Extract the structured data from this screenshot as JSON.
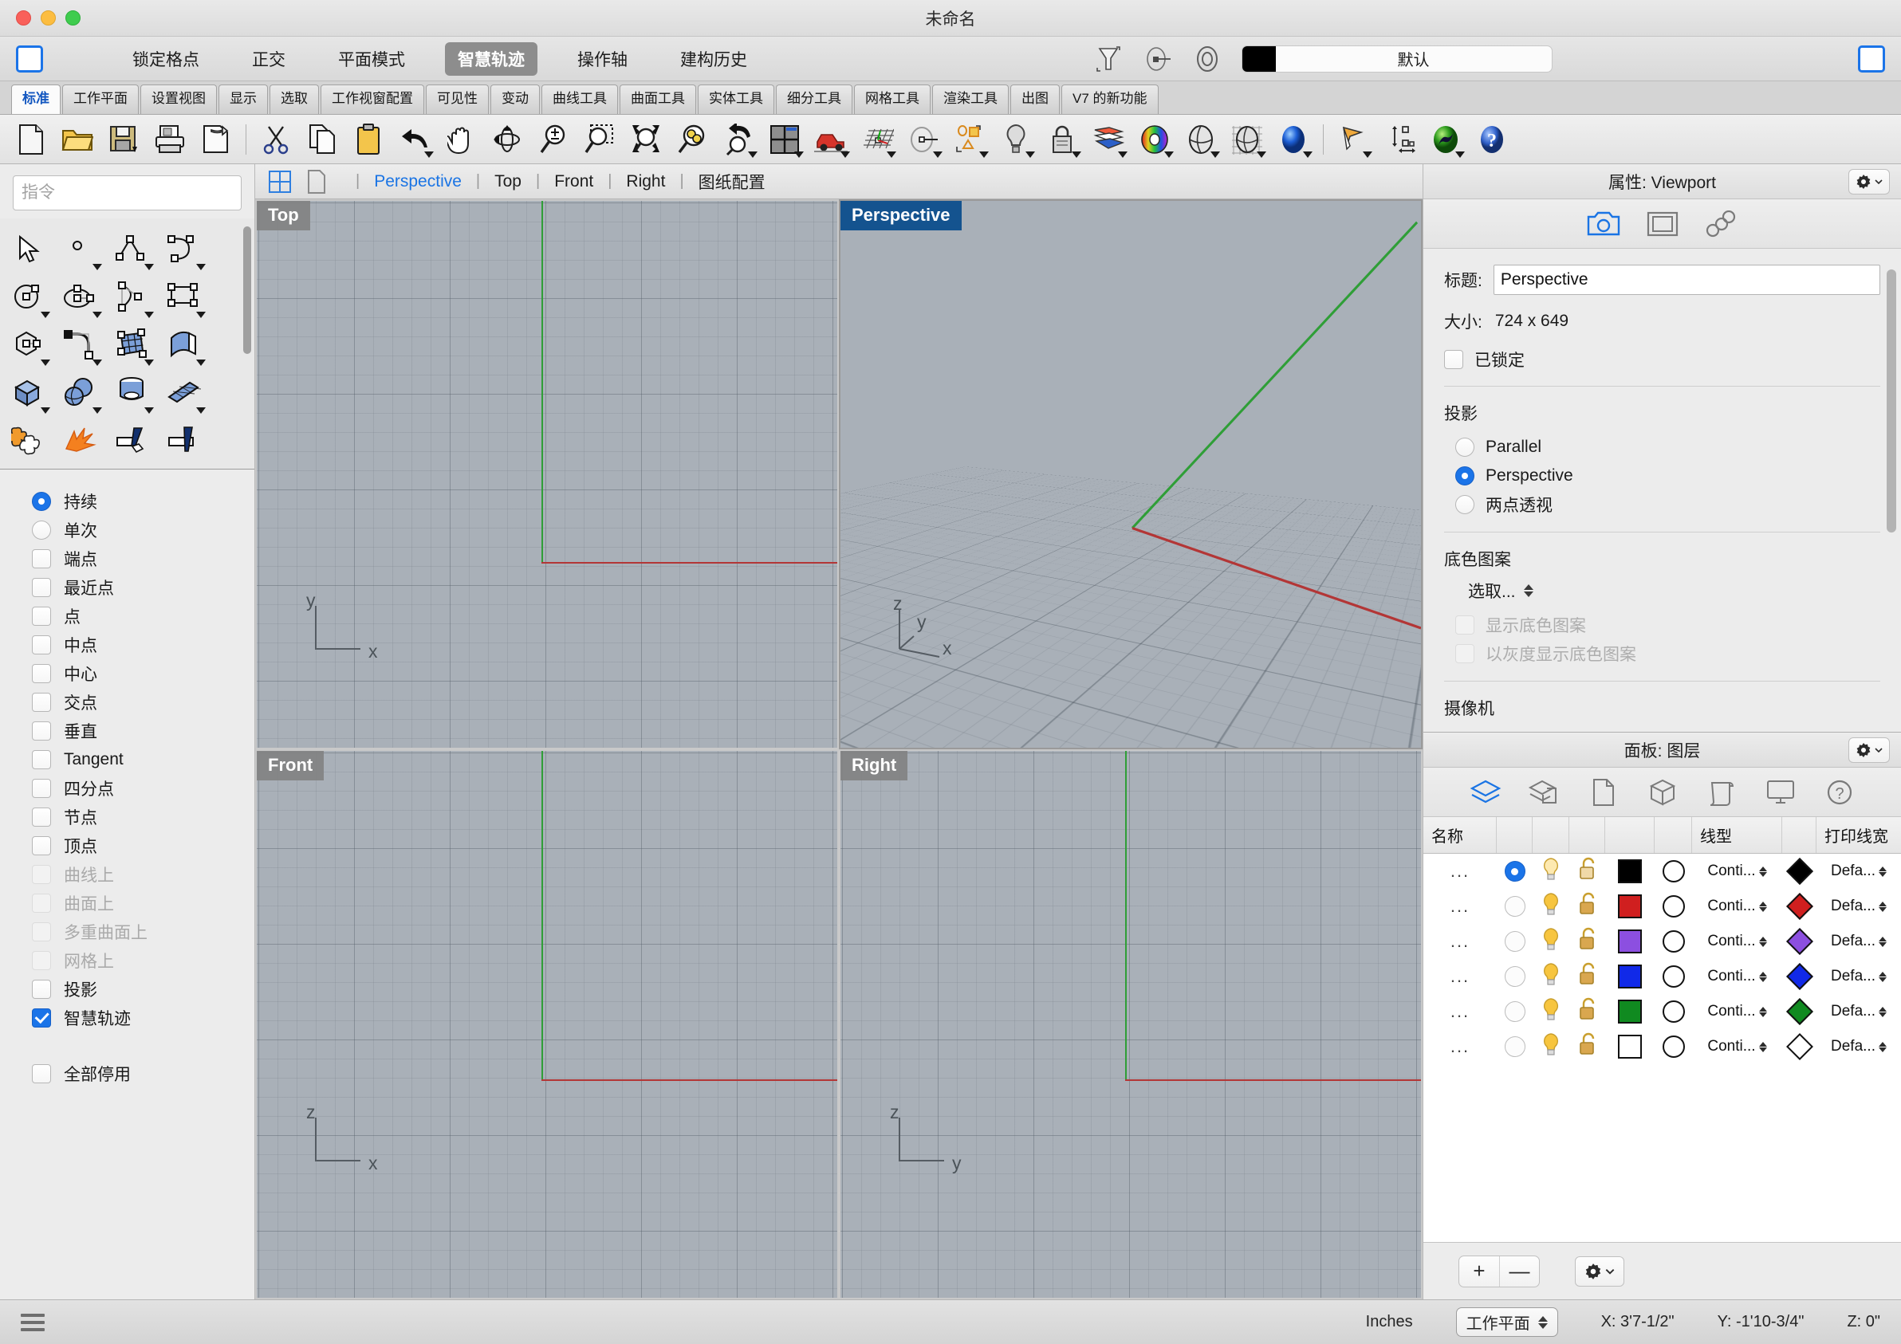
{
  "window": {
    "title": "未命名"
  },
  "modebar": {
    "left_panel_toggle": "left-panel-toggle",
    "right_panel_toggle": "right-panel-toggle",
    "items": [
      {
        "label": "锁定格点",
        "active": false
      },
      {
        "label": "正交",
        "active": false
      },
      {
        "label": "平面模式",
        "active": false
      },
      {
        "label": "智慧轨迹",
        "active": true
      },
      {
        "label": "操作轴",
        "active": false
      },
      {
        "label": "建构历史",
        "active": false
      }
    ],
    "layer_combo": {
      "color": "#000000",
      "label": "默认"
    }
  },
  "tabs": [
    {
      "label": "标准",
      "active": true
    },
    {
      "label": "工作平面",
      "active": false
    },
    {
      "label": "设置视图",
      "active": false
    },
    {
      "label": "显示",
      "active": false
    },
    {
      "label": "选取",
      "active": false
    },
    {
      "label": "工作视窗配置",
      "active": false
    },
    {
      "label": "可见性",
      "active": false
    },
    {
      "label": "变动",
      "active": false
    },
    {
      "label": "曲线工具",
      "active": false
    },
    {
      "label": "曲面工具",
      "active": false
    },
    {
      "label": "实体工具",
      "active": false
    },
    {
      "label": "细分工具",
      "active": false
    },
    {
      "label": "网格工具",
      "active": false
    },
    {
      "label": "渲染工具",
      "active": false
    },
    {
      "label": "出图",
      "active": false
    },
    {
      "label": "V7 的新功能",
      "active": false
    }
  ],
  "toolbar": {
    "icons": [
      "new-document-icon",
      "open-folder-icon",
      "save-disk-icon",
      "print-icon",
      "export-icon",
      "cut-scissors-icon",
      "copy-icon",
      "paste-clipboard-icon",
      "undo-arrow-icon",
      "pan-hand-icon",
      "rotate-view-icon",
      "zoom-in-out-icon",
      "zoom-window-icon",
      "zoom-extents-icon",
      "zoom-selected-icon",
      "zoom-previous-icon",
      "viewport-layout-icon",
      "walkthrough-car-icon",
      "cplane-grid-icon",
      "ellipse-cplane-icon",
      "object-snap-icon",
      "light-bulb-icon",
      "lock-icon",
      "render-mesh-icon",
      "color-wheel-icon",
      "shaded-sphere-icon",
      "ghosted-sphere-icon",
      "render-sphere-icon",
      "layout-pointer-icon",
      "dimension-icon",
      "render-earth-icon",
      "help-icon"
    ]
  },
  "command": {
    "placeholder": "指令",
    "value": ""
  },
  "left_palette": {
    "rows": [
      [
        "select-arrow-icon",
        "point-icon",
        "polyline-icon",
        "curve-icon"
      ],
      [
        "circle-icon",
        "ellipse-icon",
        "arc-icon",
        "rectangle-icon"
      ],
      [
        "polygon-icon",
        "fillet-curve-icon",
        "surface-from-points-icon",
        "extrude-surface-icon"
      ],
      [
        "box-icon",
        "sphere-icon",
        "cylinder-icon",
        "surface-plane-icon"
      ],
      [
        "boolean-union-icon",
        "explode-icon",
        "trim-icon",
        "split-icon"
      ]
    ]
  },
  "osnap": {
    "options": [
      {
        "label": "持续",
        "type": "radio",
        "checked": true,
        "disabled": false
      },
      {
        "label": "单次",
        "type": "radio",
        "checked": false,
        "disabled": false
      },
      {
        "label": "端点",
        "type": "checkbox",
        "checked": false,
        "disabled": false
      },
      {
        "label": "最近点",
        "type": "checkbox",
        "checked": false,
        "disabled": false
      },
      {
        "label": "点",
        "type": "checkbox",
        "checked": false,
        "disabled": false
      },
      {
        "label": "中点",
        "type": "checkbox",
        "checked": false,
        "disabled": false
      },
      {
        "label": "中心",
        "type": "checkbox",
        "checked": false,
        "disabled": false
      },
      {
        "label": "交点",
        "type": "checkbox",
        "checked": false,
        "disabled": false
      },
      {
        "label": "垂直",
        "type": "checkbox",
        "checked": false,
        "disabled": false
      },
      {
        "label": "Tangent",
        "type": "checkbox",
        "checked": false,
        "disabled": false
      },
      {
        "label": "四分点",
        "type": "checkbox",
        "checked": false,
        "disabled": false
      },
      {
        "label": "节点",
        "type": "checkbox",
        "checked": false,
        "disabled": false
      },
      {
        "label": "顶点",
        "type": "checkbox",
        "checked": false,
        "disabled": false
      },
      {
        "label": "曲线上",
        "type": "checkbox",
        "checked": false,
        "disabled": true
      },
      {
        "label": "曲面上",
        "type": "checkbox",
        "checked": false,
        "disabled": true
      },
      {
        "label": "多重曲面上",
        "type": "checkbox",
        "checked": false,
        "disabled": true
      },
      {
        "label": "网格上",
        "type": "checkbox",
        "checked": false,
        "disabled": true
      },
      {
        "label": "投影",
        "type": "checkbox",
        "checked": false,
        "disabled": false
      },
      {
        "label": "智慧轨迹",
        "type": "checkbox",
        "checked": true,
        "disabled": false
      }
    ],
    "disable_all": {
      "label": "全部停用",
      "checked": false
    }
  },
  "viewport_bar": {
    "layout_icons": [
      "four-view-layout-icon",
      "single-view-layout-icon"
    ],
    "tabs": [
      {
        "label": "Perspective",
        "active": true
      },
      {
        "label": "Top",
        "active": false
      },
      {
        "label": "Front",
        "active": false
      },
      {
        "label": "Right",
        "active": false
      },
      {
        "label": "图纸配置",
        "active": false
      }
    ]
  },
  "viewports": [
    {
      "name": "Top",
      "active": false,
      "axes": [
        "y",
        "x"
      ]
    },
    {
      "name": "Perspective",
      "active": true,
      "axes": [
        "z",
        "y",
        "x"
      ]
    },
    {
      "name": "Front",
      "active": false,
      "axes": [
        "z",
        "x"
      ]
    },
    {
      "name": "Right",
      "active": false,
      "axes": [
        "z",
        "y"
      ]
    }
  ],
  "properties": {
    "header": "属性: Viewport",
    "icon_tabs": [
      "camera-icon",
      "viewport-frame-icon",
      "object-links-icon"
    ],
    "title_label": "标题:",
    "title_value": "Perspective",
    "size_label": "大小:",
    "size_value": "724 x 649",
    "locked": {
      "label": "已锁定",
      "checked": false
    },
    "projection": {
      "group_label": "投影",
      "options": [
        {
          "label": "Parallel",
          "checked": false
        },
        {
          "label": "Perspective",
          "checked": true
        },
        {
          "label": "两点透视",
          "checked": false
        }
      ]
    },
    "wallpaper": {
      "group_label": "底色图案",
      "select_label": "选取...",
      "show": {
        "label": "显示底色图案",
        "checked": false,
        "disabled": true
      },
      "grayscale": {
        "label": "以灰度显示底色图案",
        "checked": false,
        "disabled": true
      }
    },
    "camera_label": "摄像机"
  },
  "layers": {
    "header": "面板: 图层",
    "icon_tabs": [
      "layers-icon",
      "sublayer-icon",
      "document-icon",
      "object-icon",
      "scroll-icon",
      "display-icon",
      "help-icon"
    ],
    "columns": [
      "名称",
      "",
      "",
      "",
      "",
      "",
      "线型",
      "",
      "打印线宽"
    ],
    "rows": [
      {
        "name": "...",
        "current": true,
        "on": true,
        "locked": false,
        "color": "#000000",
        "linetype": "Conti...",
        "print_color": "#000000",
        "print_width": "Defa..."
      },
      {
        "name": "...",
        "current": false,
        "on": true,
        "locked": false,
        "color": "#d01f1f",
        "linetype": "Conti...",
        "print_color": "#d01f1f",
        "print_width": "Defa..."
      },
      {
        "name": "...",
        "current": false,
        "on": true,
        "locked": false,
        "color": "#8c4fe0",
        "linetype": "Conti...",
        "print_color": "#8c4fe0",
        "print_width": "Defa..."
      },
      {
        "name": "...",
        "current": false,
        "on": true,
        "locked": false,
        "color": "#1129e8",
        "linetype": "Conti...",
        "print_color": "#1129e8",
        "print_width": "Defa..."
      },
      {
        "name": "...",
        "current": false,
        "on": true,
        "locked": false,
        "color": "#108a20",
        "linetype": "Conti...",
        "print_color": "#108a20",
        "print_width": "Defa..."
      },
      {
        "name": "...",
        "current": false,
        "on": true,
        "locked": false,
        "color": "#ffffff",
        "linetype": "Conti...",
        "print_color": "#ffffff",
        "print_width": "Defa..."
      }
    ],
    "footer": {
      "add": "+",
      "remove": "—",
      "gear": "gear-icon"
    }
  },
  "statusbar": {
    "menu_icon": "hamburger-menu-icon",
    "units": "Inches",
    "cplane": "工作平面",
    "x": "X: 3'7-1/2\"",
    "y": "Y: -1'10-3/4\"",
    "z": "Z: 0\""
  }
}
